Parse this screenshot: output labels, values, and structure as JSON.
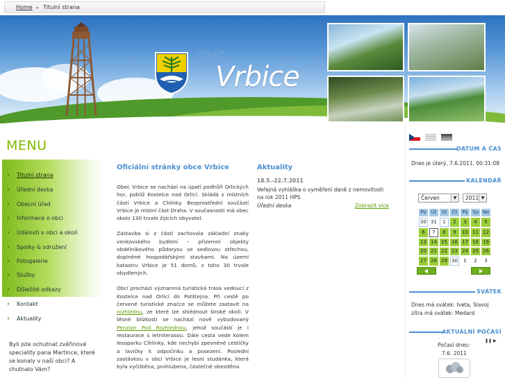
{
  "breadcrumb": {
    "home": "Home",
    "current": "Titulní strana"
  },
  "header": {
    "obec": "OBEC",
    "name": "Vrbice"
  },
  "menu": {
    "title": "MENU",
    "items": [
      "Titulní strana",
      "Úřední deska",
      "Obecní úřad",
      "Informace o obci",
      "Události v obci a okolí",
      "Spolky & sdružení",
      "Fotogalerie",
      "Služby",
      "Důležité odkazy",
      "Kontakt",
      "Aktuality"
    ],
    "promo": "Byli jste ochutnat zvěřinové speciality pana Martince, které se konaly v naší obci? A chutnalo Vám?"
  },
  "main": {
    "title": "Oficiální stránky obce Vrbice",
    "p1": "Obec Vrbice se nachází na úpatí podhůří Orlických hor, poblíž Kostelce nad Orlicí. Skládá z místních částí Vrbice a Chlínky. Bezprostřední součástí Vrbice je místní část Draha. V současnosti má obec okolo 130 trvale žijících obyvatel.",
    "p2": "Zástavba si z části zachovala základní znaky venkovského bydlení – přízemní objekty obdélníkového půdorysu se sedlovou střechou, doplněné hospodářskými stavbami. Na území katastru Vrbice je 51 domů, z toho 30 trvale obydlených.",
    "p3a": "Obcí prochází významná turistická trasa vedoucí z Kostelce nad Orlicí do Potštejna. Při cestě po červeně turistické značce se můžete zastavit na ",
    "link1": "rozhlednu",
    "p3b": ", ze které lze shlédnout široké okolí. V těsné blízkosti se nachází nově vybudovaný ",
    "link2": "Penzion Pod Rozhlednou",
    "p3c": ", jehož součástí je i restaurace s letniterasou. Dále cesta vede kolem lesoparku Cihlinky, kde nechybí zpevněné cestičky a lavičky k odpočinku a posezení. Poslední zastávkou v obci Vrbice je lesní studánka, která byla vyčištěna, prohlubena, částečně obezděna"
  },
  "news": {
    "title": "Aktuality",
    "date": "18.5.-22.7.2011",
    "text": "Veřejná vyhláška o vyměření daně z nemovitosti na rok 2011 HPS",
    "category": "Úřední deska",
    "more": "Zobrazit více"
  },
  "sidebar": {
    "datetime_title": "DATUM A ČAS",
    "datetime_text": "Dnes je úterý, 7.6.2011, 00:31:08",
    "calendar_title": "KALENDÁŘ",
    "month": "Červen",
    "year": "2011",
    "weekdays": [
      "Po",
      "Út",
      "St",
      "Čt",
      "Pá",
      "So",
      "Ne"
    ],
    "weeks": [
      [
        "30",
        "31",
        "1",
        "2",
        "3",
        "4",
        "5"
      ],
      [
        "6",
        "7",
        "8",
        "9",
        "10",
        "11",
        "12"
      ],
      [
        "13",
        "14",
        "15",
        "16",
        "17",
        "18",
        "19"
      ],
      [
        "20",
        "21",
        "22",
        "23",
        "24",
        "25",
        "26"
      ],
      [
        "27",
        "28",
        "29",
        "30",
        "1",
        "2",
        "3"
      ]
    ],
    "nameday_title": "SVÁTEK",
    "nameday_text": "Dnes má svátek: Iveta, Slavoj zítra má svátek: Medard",
    "weather_title": "AKTUÁLNÍ POČASÍ",
    "weather_label": "Počasí dnes:",
    "weather_date": "7.6. 2011"
  },
  "colors": {
    "accent_green": "#7fb800",
    "accent_blue": "#4a8fd0",
    "calendar_green": "#9bcf3a"
  }
}
